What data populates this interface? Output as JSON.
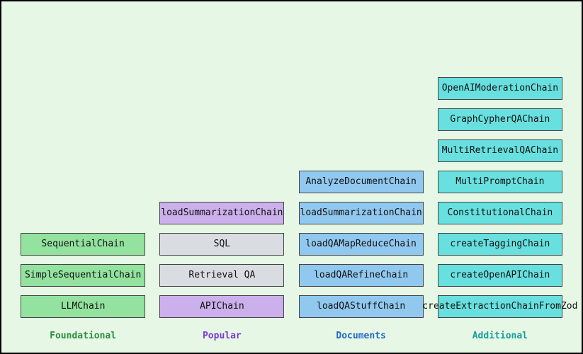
{
  "columns": [
    {
      "key": "foundational",
      "label": "Foundational",
      "labelColor": "green",
      "boxColor": "c-green",
      "items": [
        {
          "text": "SequentialChain"
        },
        {
          "text": "SimpleSequentialChain"
        },
        {
          "text": "LLMChain"
        }
      ]
    },
    {
      "key": "popular",
      "label": "Popular",
      "labelColor": "purple",
      "boxColor": "c-purple",
      "items": [
        {
          "text": "loadSummarizationChain",
          "color": "c-purple"
        },
        {
          "text": "SQL",
          "color": "c-gray"
        },
        {
          "text": "Retrieval QA",
          "color": "c-gray"
        },
        {
          "text": "APIChain",
          "color": "c-purple"
        }
      ]
    },
    {
      "key": "documents",
      "label": "Documents",
      "labelColor": "blue",
      "boxColor": "c-blue",
      "items": [
        {
          "text": "AnalyzeDocumentChain"
        },
        {
          "text": "loadSummarizationChain"
        },
        {
          "text": "loadQAMapReduceChain"
        },
        {
          "text": "loadQARefineChain"
        },
        {
          "text": "loadQAStuffChain"
        }
      ]
    },
    {
      "key": "additional",
      "label": "Additional",
      "labelColor": "teal",
      "boxColor": "c-teal",
      "items": [
        {
          "text": "OpenAIModerationChain"
        },
        {
          "text": "GraphCypherQAChain"
        },
        {
          "text": "MultiRetrievalQAChain"
        },
        {
          "text": "MultiPromptChain"
        },
        {
          "text": "ConstitutionalChain"
        },
        {
          "text": "createTaggingChain"
        },
        {
          "text": "createOpenAPIChain"
        },
        {
          "text": "createExtractionChainFromZod"
        }
      ]
    }
  ]
}
